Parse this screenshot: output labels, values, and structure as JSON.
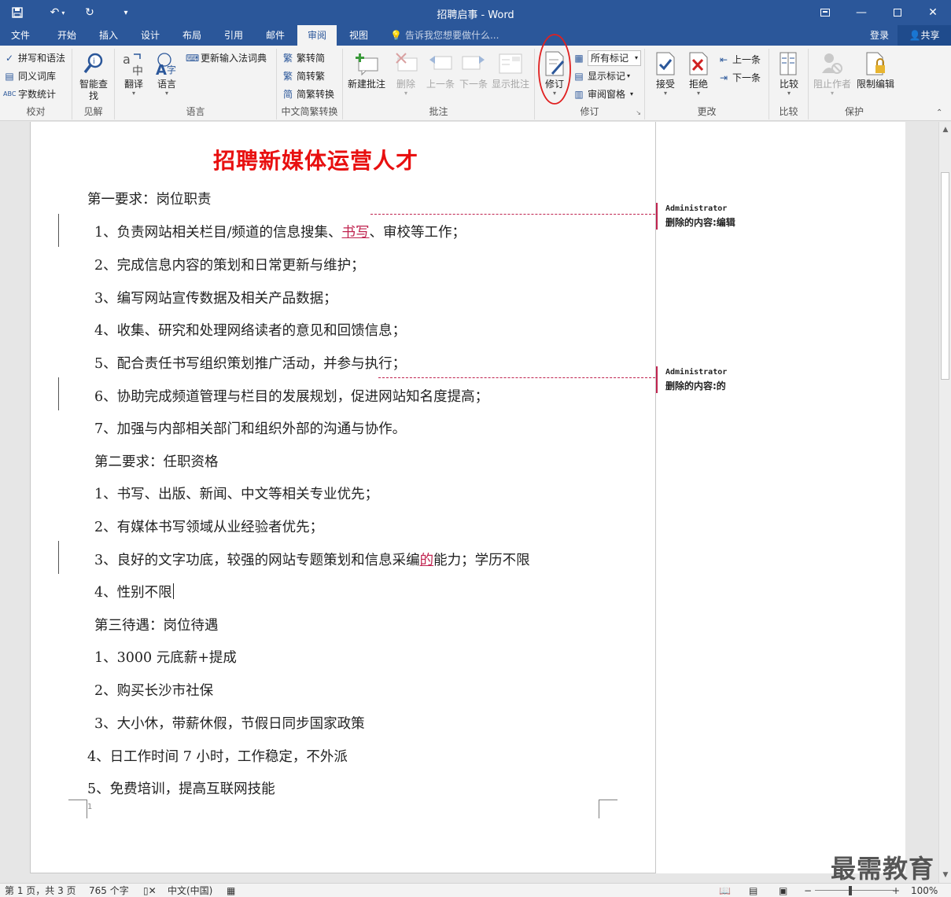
{
  "window": {
    "title": "招聘启事 - Word"
  },
  "tabs": {
    "file": "文件",
    "home": "开始",
    "insert": "插入",
    "design": "设计",
    "layout": "布局",
    "references": "引用",
    "mailings": "邮件",
    "review": "审阅",
    "view": "视图",
    "tellme": "告诉我您想要做什么...",
    "login": "登录",
    "share": "共享"
  },
  "ribbon": {
    "proofing": {
      "label": "校对",
      "spelling": "拼写和语法",
      "thesaurus": "同义词库",
      "wordcount": "字数统计"
    },
    "insights": {
      "label": "见解",
      "smartlookup": "智能查找"
    },
    "language": {
      "label": "语言",
      "translate": "翻译",
      "language": "语言",
      "ime": "更新输入法词典"
    },
    "chinese": {
      "label": "中文简繁转换",
      "to_trad": "繁转简",
      "to_simp": "简转繁",
      "convert": "简繁转换"
    },
    "comments": {
      "label": "批注",
      "new": "新建批注",
      "delete": "删除",
      "prev": "上一条",
      "next": "下一条",
      "show": "显示批注"
    },
    "tracking": {
      "label": "修订",
      "track": "修订",
      "markup_select": "所有标记",
      "show_markup": "显示标记",
      "review_pane": "审阅窗格"
    },
    "changes": {
      "label": "更改",
      "accept": "接受",
      "reject": "拒绝",
      "prev": "上一条",
      "next": "下一条"
    },
    "compare": {
      "label": "比较",
      "compare": "比较"
    },
    "protect": {
      "label": "保护",
      "block": "阻止作者",
      "restrict": "限制编辑"
    }
  },
  "document": {
    "title": "招聘新媒体运营人才",
    "lines": [
      "第一要求：岗位职责",
      "1、负责网站相关栏目/频道的信息搜集、",
      "书写",
      "、审校等工作；",
      "2、完成信息内容的策划和日常更新与维护；",
      "3、编写网站宣传数据及相关产品数据；",
      "4、收集、研究和处理网络读者的意见和回馈信息；",
      "5、配合责任书写组织策划推广活动，并参与执行；",
      "6、协助完成频道管理与栏目的发展规划，促进网站知名度提高；",
      "7、加强与内部相关部门和组织外部的沟通与协作。",
      "第二要求：任职资格",
      "1、书写、出版、新闻、中文等相关专业优先；",
      "2、有媒体书写领域从业经验者优先；",
      "3、良好的文字功底，较强的网站专题策划和信息采编",
      "的",
      "能力；学历不限",
      "4、性别不限",
      "第三待遇：岗位待遇",
      "1、3000 元底薪+提成",
      "2、购买长沙市社保",
      "3、大小休，带薪休假，节假日同步国家政策",
      "4、日工作时间 7 小时，工作稳定，不外派",
      "5、免费培训，提高互联网技能"
    ],
    "page_number": "1"
  },
  "comments": [
    {
      "author": "Administrator",
      "text": "删除的内容:编辑"
    },
    {
      "author": "Administrator",
      "text": "删除的内容:的"
    }
  ],
  "status": {
    "page": "第 1 页，共 3 页",
    "words": "765 个字",
    "lang": "中文(中国)",
    "zoom": "100%"
  },
  "watermark": "最需教育"
}
